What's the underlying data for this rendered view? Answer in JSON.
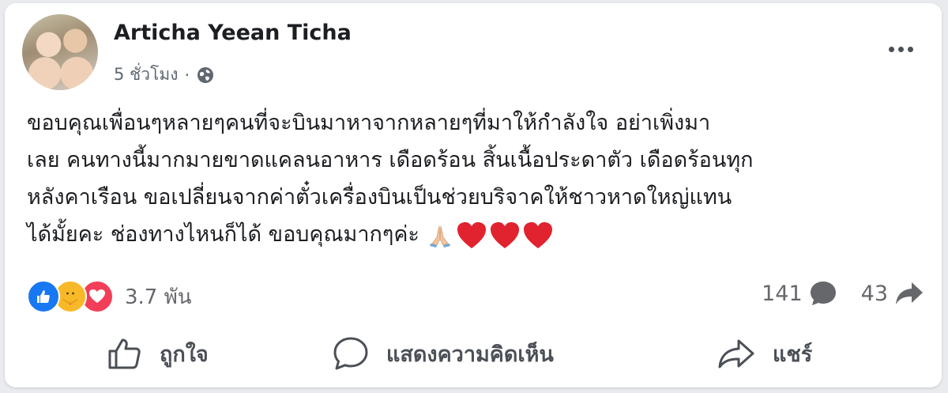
{
  "post": {
    "author": "Articha Yeean Ticha",
    "time": "5 ชั่วโมง",
    "separator": "·",
    "privacy_icon": "globe-icon",
    "lines": [
      "ขอบคุณเพื่อนๆหลายๆคนที่จะบินมาหาจากหลายๆที่มาให้กำลังใจ อย่าเพิ่งมา",
      "เลย คนทางนี้มากมายขาดแคลนอาหาร เดือดร้อน สิ้นเนื้อประดาตัว เดือดร้อนทุก",
      "หลังคาเรือน ขอเปลี่ยนจากค่าตั๋วเครื่องบินเป็นช่วยบริจาคให้ชาวหาดใหญ่แทน",
      "ได้มั้ยคะ ช่องทางไหนก็ได้ ขอบคุณมากๆค่ะ"
    ],
    "emojis": [
      "folded-hands",
      "red-heart",
      "red-heart",
      "red-heart"
    ]
  },
  "stats": {
    "reaction_types": [
      "like",
      "care",
      "love"
    ],
    "reaction_count": "3.7 พัน",
    "comment_count": "141",
    "share_count": "43"
  },
  "actions": {
    "like_label": "ถูกใจ",
    "comment_label": "แสดงความคิดเห็น",
    "share_label": "แชร์"
  },
  "colors": {
    "like_blue": "#1877f2",
    "care_yellow": "#f7b928",
    "love_red": "#f33e58",
    "heart_red": "#e0232e",
    "text_dark": "#1c1e21",
    "text_muted": "#65676b"
  }
}
